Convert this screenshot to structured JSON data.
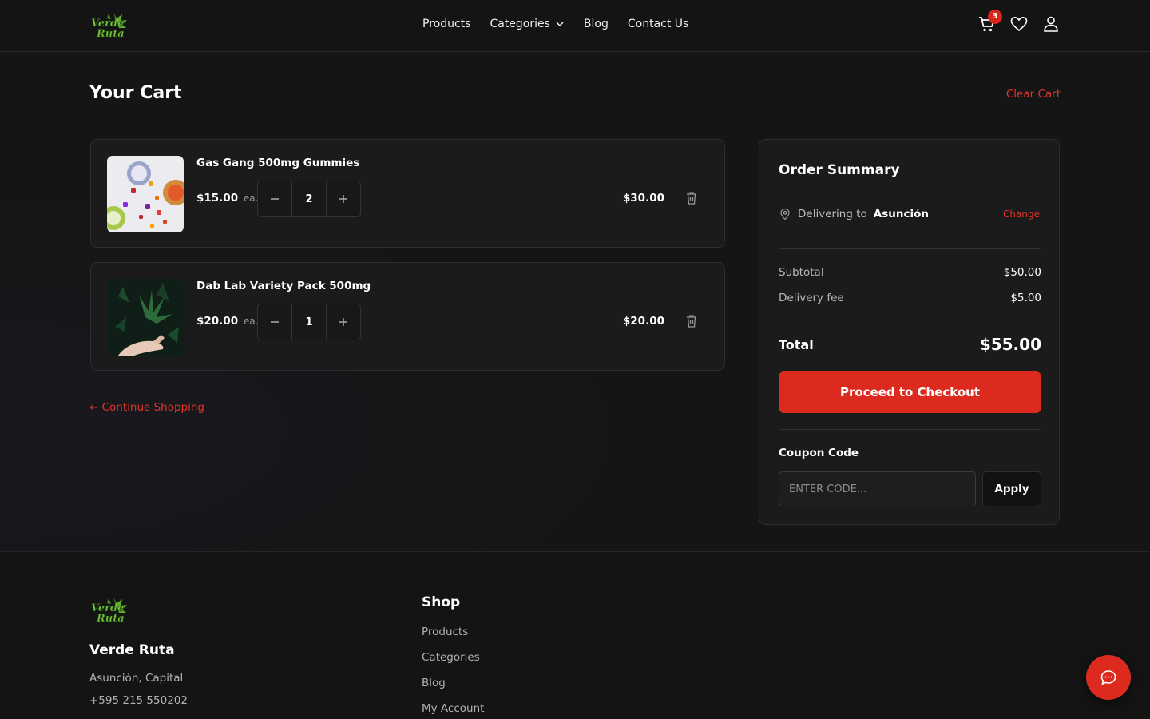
{
  "brand": {
    "logo_text_line1": "Verde",
    "logo_text_line2": "Ruta"
  },
  "nav": {
    "items": [
      {
        "label": "Products"
      },
      {
        "label": "Categories",
        "has_dropdown": true
      },
      {
        "label": "Blog"
      },
      {
        "label": "Contact Us"
      }
    ]
  },
  "header_icons": {
    "cart_count": "3",
    "cart_icon": "cart-icon",
    "wishlist_icon": "heart-icon",
    "account_icon": "user-icon"
  },
  "cart": {
    "title": "Your Cart",
    "clear_label": "Clear Cart",
    "items": [
      {
        "name": "Gas Gang 500mg Gummies",
        "unit_price": "$15.00",
        "unit_suffix": "ea.",
        "quantity": "2",
        "line_total": "$30.00",
        "image": "gummies-product-image"
      },
      {
        "name": "Dab Lab Variety Pack 500mg",
        "unit_price": "$20.00",
        "unit_suffix": "ea.",
        "quantity": "1",
        "line_total": "$20.00",
        "image": "cannabis-leaf-image"
      }
    ],
    "continue_label": "← Continue Shopping"
  },
  "summary": {
    "title": "Order Summary",
    "delivering_prefix": "Delivering to",
    "delivering_city": "Asunción",
    "change_label": "Change",
    "subtotal_label": "Subtotal",
    "subtotal_value": "$50.00",
    "delivery_label": "Delivery fee",
    "delivery_value": "$5.00",
    "total_label": "Total",
    "total_value": "$55.00",
    "checkout_label": "Proceed to Checkout",
    "coupon_label": "Coupon Code",
    "coupon_placeholder": "ENTER CODE...",
    "coupon_value": "",
    "apply_label": "Apply"
  },
  "footer": {
    "brand_name": "Verde Ruta",
    "address": "Asunción, Capital",
    "phone": "+595 215 550202",
    "shop_title": "Shop",
    "shop_links": [
      "Products",
      "Categories",
      "Blog",
      "My Account"
    ]
  },
  "colors": {
    "accent": "#dd2a1f",
    "background": "#151515",
    "card": "#1b1b1b",
    "logo_green": "#5fae2e"
  }
}
